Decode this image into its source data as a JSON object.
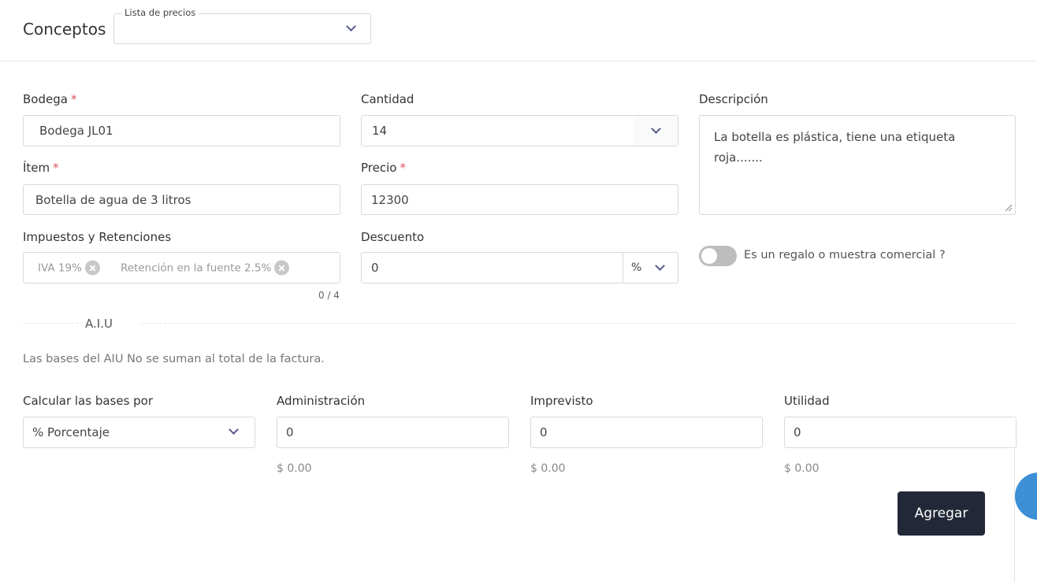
{
  "header": {
    "title": "Conceptos",
    "price_list": {
      "legend": "Lista de precios",
      "value": ""
    }
  },
  "form": {
    "bodega": {
      "label": "Bodega",
      "required_mark": "*",
      "value": "Bodega JL01"
    },
    "cantidad": {
      "label": "Cantidad",
      "value": "14"
    },
    "descripcion": {
      "label": "Descripción",
      "value": "La botella es plástica, tiene una etiqueta roja......."
    },
    "item": {
      "label": "Ítem",
      "required_mark": "*",
      "value": "Botella de agua de 3 litros"
    },
    "precio": {
      "label": "Precio",
      "required_mark": "*",
      "value": "12300"
    },
    "impuestos": {
      "label": "Impuestos y Retenciones",
      "tags": [
        "IVA 19%",
        "Retención en la fuente 2.5%"
      ],
      "counter": "0 / 4"
    },
    "descuento": {
      "label": "Descuento",
      "value": "0",
      "unit": "%"
    },
    "gift": {
      "label": "Es un regalo o muestra comercial ?",
      "enabled": false
    }
  },
  "aiu": {
    "section_title": "A.I.U",
    "note": "Las bases del AIU No se suman al total de la factura.",
    "calc": {
      "label": "Calcular las bases por",
      "value": "% Porcentaje"
    },
    "administracion": {
      "label": "Administración",
      "value": "0",
      "amount": "$ 0.00"
    },
    "imprevisto": {
      "label": "Imprevisto",
      "value": "0",
      "amount": "$ 0.00"
    },
    "utilidad": {
      "label": "Utilidad",
      "value": "0",
      "amount": "$ 0.00"
    }
  },
  "actions": {
    "add_label": "Agregar"
  },
  "colors": {
    "primary_button": "#232838",
    "required": "#e0525e",
    "chevron": "#555a8a",
    "toggle_off": "#bdbdbd",
    "accent_blue": "#3d8fd6"
  },
  "icons": {
    "dropdown": "chevron-down-icon",
    "tag_remove": "close-circle-icon",
    "resize": "resize-handle-icon"
  }
}
